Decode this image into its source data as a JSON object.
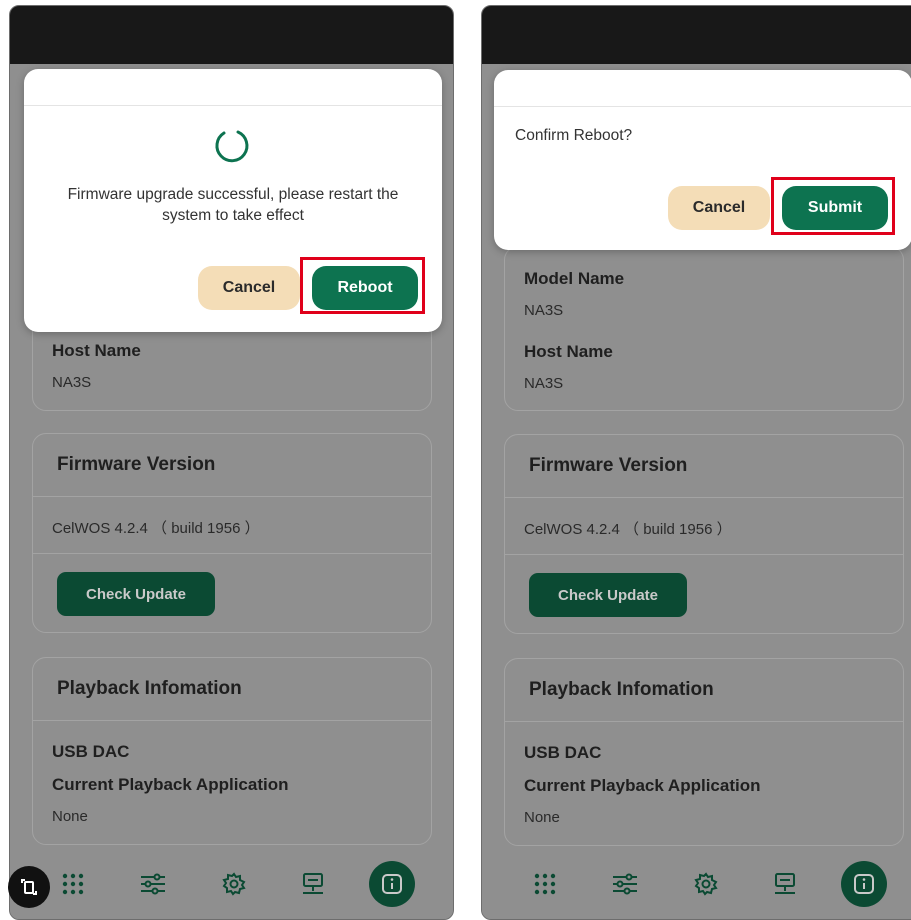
{
  "left": {
    "dialog": {
      "message": "Firmware upgrade successful, please restart the system to take effect",
      "cancel_label": "Cancel",
      "reboot_label": "Reboot"
    },
    "device_info": {
      "host_name_label": "Host Name",
      "host_name_value": "NA3S"
    },
    "firmware": {
      "title": "Firmware Version",
      "version": "CelWOS 4.2.4 （ build 1956 ）",
      "check_update_label": "Check Update"
    },
    "playback": {
      "title": "Playback Infomation",
      "usb_dac_label": "USB DAC",
      "current_app_label": "Current Playback Application",
      "current_app_value": "None"
    }
  },
  "right": {
    "dialog": {
      "message": "Confirm Reboot?",
      "cancel_label": "Cancel",
      "submit_label": "Submit"
    },
    "device_info": {
      "model_name_label": "Model Name",
      "model_name_value": "NA3S",
      "host_name_label": "Host Name",
      "host_name_value": "NA3S"
    },
    "firmware": {
      "title": "Firmware Version",
      "version": "CelWOS 4.2.4 （ build 1956 ）",
      "check_update_label": "Check Update"
    },
    "playback": {
      "title": "Playback Infomation",
      "usb_dac_label": "USB DAC",
      "current_app_label": "Current Playback Application",
      "current_app_value": "None"
    }
  },
  "nav_items": [
    "grid-icon",
    "sliders-icon",
    "gear-icon",
    "network-icon",
    "info-icon"
  ],
  "colors": {
    "brand_green": "#0d7350",
    "cancel_bg": "#f4ddb7",
    "highlight_red": "#e0001a",
    "overlay_gray": "#8f8f8f"
  }
}
